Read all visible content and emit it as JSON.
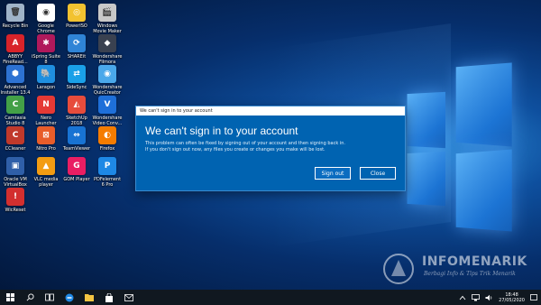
{
  "desktop": {
    "icons": [
      {
        "id": "recycle-bin",
        "label": "Recycle Bin",
        "color": "#9fb3c8",
        "glyph": "🗑"
      },
      {
        "id": "google-chrome",
        "label": "Google\nChrome",
        "color": "#ffffff",
        "glyph": "◉"
      },
      {
        "id": "poweriso",
        "label": "PowerISO",
        "color": "#f2c230",
        "glyph": "◎"
      },
      {
        "id": "windows-movie-maker",
        "label": "Windows\nMovie Maker",
        "color": "#c8c8c8",
        "glyph": "🎬"
      },
      {
        "id": "abbyy-finereader",
        "label": "ABBYY\nFineRead...",
        "color": "#d8232a",
        "glyph": "A"
      },
      {
        "id": "ispring-suite",
        "label": "iSpring Suite\n8",
        "color": "#b0195b",
        "glyph": "✱"
      },
      {
        "id": "shareit",
        "label": "SHAREit",
        "color": "#2f84d6",
        "glyph": "⟳"
      },
      {
        "id": "wondershare-filmora",
        "label": "Wondershare\nFilmora",
        "color": "#3a4150",
        "glyph": "◆"
      },
      {
        "id": "advanced-installer",
        "label": "Advanced\nInstaller 13.4",
        "color": "#2d72d2",
        "glyph": "⬢"
      },
      {
        "id": "laragon",
        "label": "Laragon",
        "color": "#1f8fe0",
        "glyph": "🐘"
      },
      {
        "id": "sidesync",
        "label": "SideSync",
        "color": "#1aa0e8",
        "glyph": "⇄"
      },
      {
        "id": "wondershare-quiccreator",
        "label": "Wondershare\nQuicCreator",
        "color": "#4aa8ea",
        "glyph": "◉"
      },
      {
        "id": "camtasia-studio",
        "label": "Camtasia\nStudio 8",
        "color": "#43a047",
        "glyph": "C"
      },
      {
        "id": "nero-launcher",
        "label": "Nero\nLauncher",
        "color": "#e53935",
        "glyph": "N"
      },
      {
        "id": "sketchup",
        "label": "SketchUp\n2018",
        "color": "#e74c3c",
        "glyph": "◭"
      },
      {
        "id": "wondershare-video-converter",
        "label": "Wondershare\nVideo Conv...",
        "color": "#1e6fd9",
        "glyph": "V"
      },
      {
        "id": "ccleaner",
        "label": "CCleaner",
        "color": "#c0392b",
        "glyph": "C"
      },
      {
        "id": "nitro-pro",
        "label": "Nitro Pro",
        "color": "#e85d2a",
        "glyph": "⊠"
      },
      {
        "id": "teamviewer",
        "label": "TeamViewer",
        "color": "#1873d3",
        "glyph": "⇔"
      },
      {
        "id": "firefox",
        "label": "Firefox",
        "color": "#f57c00",
        "glyph": "◐"
      },
      {
        "id": "oracle-vm-virtualbox",
        "label": "Oracle VM\nVirtualBox",
        "color": "#2f5fa8",
        "glyph": "▣"
      },
      {
        "id": "vlc-media-player",
        "label": "VLC media\nplayer",
        "color": "#f39c12",
        "glyph": "▲"
      },
      {
        "id": "gom-player",
        "label": "GOM Player",
        "color": "#e91e63",
        "glyph": "G"
      },
      {
        "id": "pdfelement",
        "label": "PDFelement\n6 Pro",
        "color": "#1e88e5",
        "glyph": "P"
      },
      {
        "id": "wicreset",
        "label": "WicReset",
        "color": "#d32f2f",
        "glyph": "!"
      }
    ]
  },
  "dialog": {
    "titlebar": "We can't sign in to your account",
    "heading": "We can't sign in to your account",
    "body_line1": "This problem can often be fixed by signing out of your account and then signing back in.",
    "body_line2": "If you don't sign out now, any files you create or changes you make will be lost.",
    "sign_out_label": "Sign out",
    "close_label": "Close"
  },
  "watermark": {
    "title": "INFOMENARIK",
    "subtitle": "Berbagi Info & Tips Trik Menarik"
  },
  "taskbar": {
    "time": "18:48",
    "date": "27/05/2020"
  }
}
